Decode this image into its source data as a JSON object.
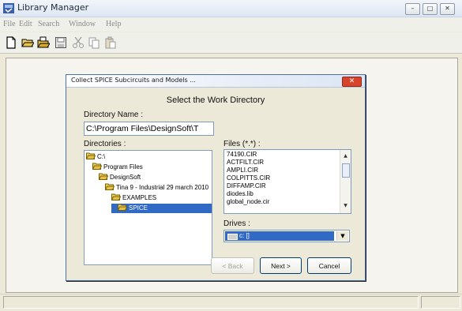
{
  "window": {
    "title": "Library Manager",
    "controls": [
      "minimize-icon",
      "maximize-icon",
      "close-icon"
    ]
  },
  "menu": [
    "File",
    "Edit",
    "Search",
    "Window",
    "Help"
  ],
  "toolbar": {
    "icons": [
      "new-file-icon",
      "open-folder-icon",
      "open-library-icon",
      "save-icon",
      "cut-icon",
      "copy-icon",
      "paste-icon"
    ]
  },
  "dialog": {
    "title": "Collect SPICE Subcircuits and Models ...",
    "heading": "Select the Work Directory",
    "directory_name_label": "Directory Name :",
    "directory_name_value": "C:\\Program Files\\DesignSoft\\T",
    "directories_label": "Directories :",
    "directories": [
      {
        "label": "C:\\",
        "depth": 0,
        "selected": false
      },
      {
        "label": "Program Files",
        "depth": 1,
        "selected": false
      },
      {
        "label": "DesignSoft",
        "depth": 2,
        "selected": false
      },
      {
        "label": "Tina 9 - Industrial 29 march 2010",
        "depth": 3,
        "selected": false
      },
      {
        "label": "EXAMPLES",
        "depth": 4,
        "selected": false
      },
      {
        "label": "SPICE",
        "depth": 5,
        "selected": true
      }
    ],
    "files_label": "Files (*.*) :",
    "files": [
      "74190.CIR",
      "ACTFILT.CIR",
      "AMPLI.CIR",
      "COLPITTS.CIR",
      "DIFFAMP.CIR",
      "diodes.lib",
      "global_node.cir"
    ],
    "drives_label": "Drives :",
    "drive_value": "c: []",
    "buttons": {
      "back": "< Back",
      "next": "Next >",
      "cancel": "Cancel"
    }
  },
  "colors": {
    "selection": "#316ac5",
    "close_button": "#d8432c"
  }
}
